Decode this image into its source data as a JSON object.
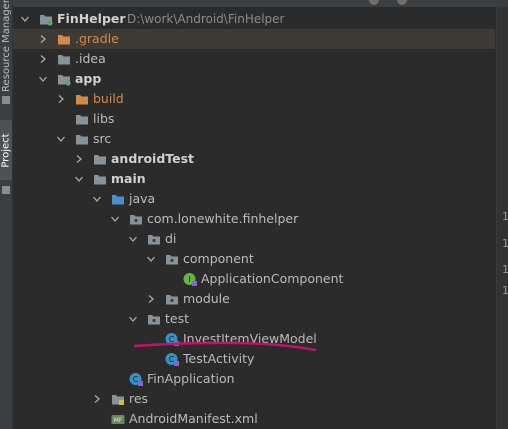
{
  "sidebar": {
    "resource_manager": "Resource Manager",
    "project": "Project"
  },
  "tree": [
    {
      "label": "FinHelper",
      "path": "D:\\work\\Android\\FinHelper",
      "icon": "module-folder-icon",
      "depth": 0,
      "expanded": true,
      "bold": true
    },
    {
      "label": ".gradle",
      "icon": "excluded-folder-icon",
      "depth": 1,
      "expanded": false,
      "selected": true
    },
    {
      "label": ".idea",
      "icon": "folder-icon",
      "depth": 1,
      "expanded": false
    },
    {
      "label": "app",
      "icon": "module-folder-icon",
      "depth": 1,
      "expanded": true,
      "bold": true
    },
    {
      "label": "build",
      "icon": "excluded-folder-icon",
      "depth": 2,
      "expanded": false
    },
    {
      "label": "libs",
      "icon": "folder-icon",
      "depth": 2
    },
    {
      "label": "src",
      "icon": "folder-icon",
      "depth": 2,
      "expanded": true
    },
    {
      "label": "androidTest",
      "icon": "folder-icon",
      "depth": 3,
      "expanded": false,
      "bold": true
    },
    {
      "label": "main",
      "icon": "folder-icon",
      "depth": 3,
      "expanded": true,
      "bold": true
    },
    {
      "label": "java",
      "icon": "source-folder-icon",
      "depth": 4,
      "expanded": true
    },
    {
      "label": "com.lonewhite.finhelper",
      "icon": "package-icon",
      "depth": 5,
      "expanded": true
    },
    {
      "label": "di",
      "icon": "package-icon",
      "depth": 6,
      "expanded": true
    },
    {
      "label": "component",
      "icon": "package-icon",
      "depth": 7,
      "expanded": true
    },
    {
      "label": "ApplicationComponent",
      "icon": "kotlin-interface-icon",
      "depth": 8
    },
    {
      "label": "module",
      "icon": "package-icon",
      "depth": 7,
      "expanded": false
    },
    {
      "label": "test",
      "icon": "package-icon",
      "depth": 6,
      "expanded": true
    },
    {
      "label": "InvestItemViewModel",
      "icon": "kotlin-class-icon",
      "depth": 7,
      "underlined": true
    },
    {
      "label": "TestActivity",
      "icon": "kotlin-class-icon",
      "depth": 7
    },
    {
      "label": "FinApplication",
      "icon": "kotlin-class-icon",
      "depth": 5
    },
    {
      "label": "res",
      "icon": "resource-folder-icon",
      "depth": 4,
      "expanded": false
    },
    {
      "label": "AndroidManifest.xml",
      "icon": "manifest-icon",
      "depth": 4
    }
  ],
  "gutter": {
    "line": "1"
  },
  "colors": {
    "underline": "#c0136c",
    "selection": "#3f3b34"
  }
}
